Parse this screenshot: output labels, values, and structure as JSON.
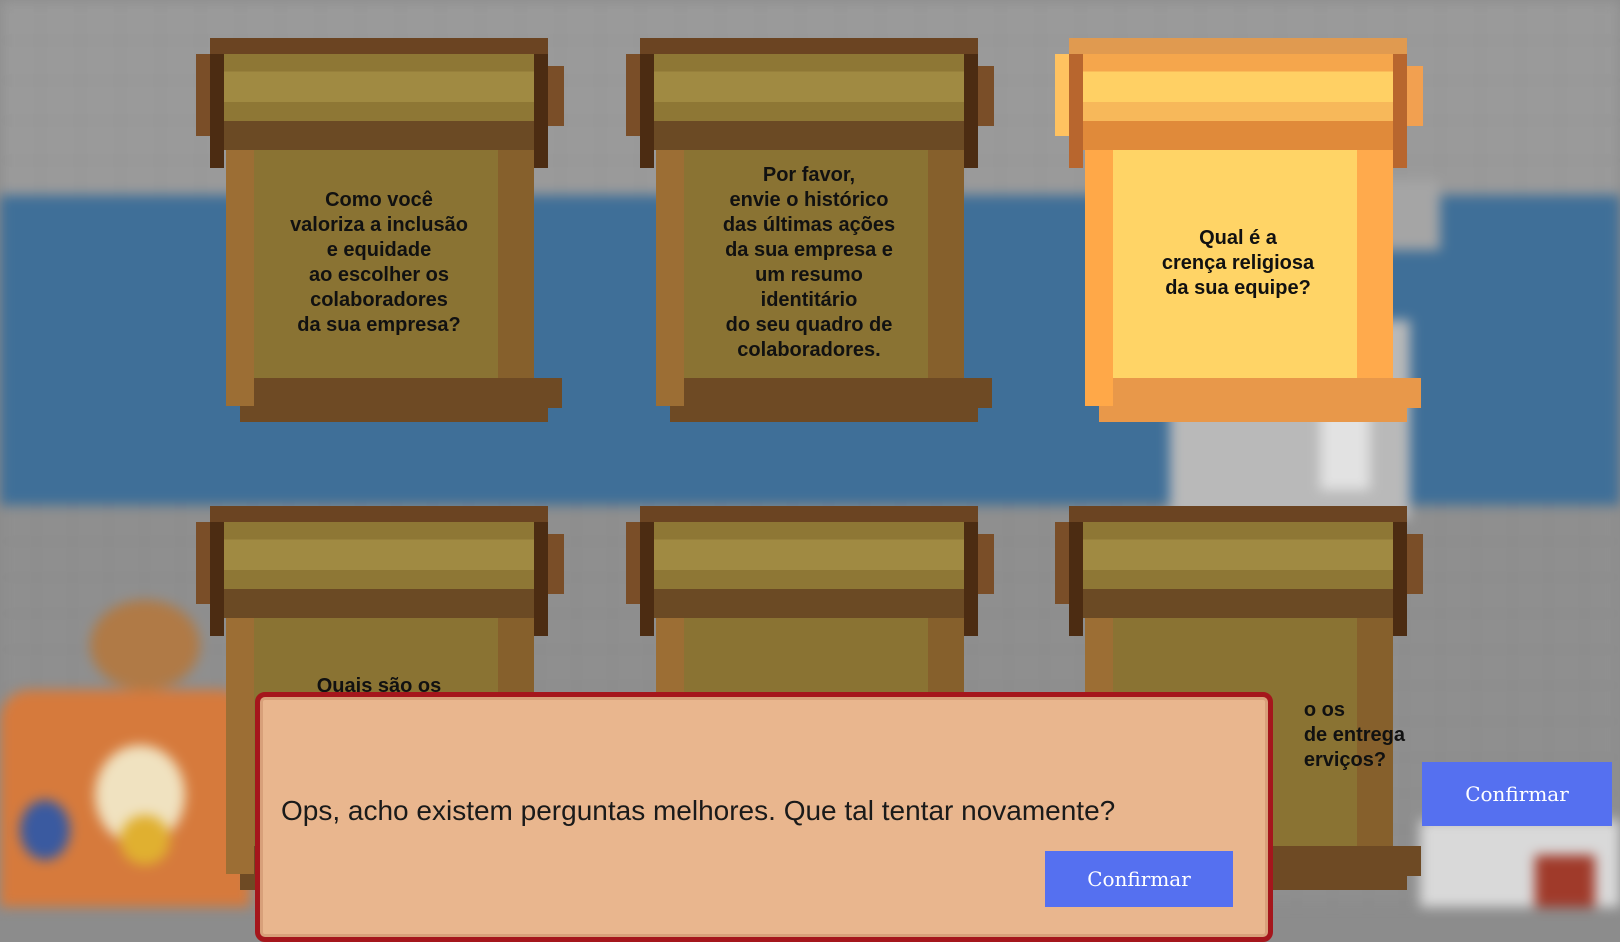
{
  "cards": [
    {
      "text": "Como você\nvaloriza a inclusão\ne equidade\nao escolher os\ncolaboradores\nda sua empresa?",
      "selected": false
    },
    {
      "text": "Por favor,\nenvie o histórico\ndas últimas ações\nda sua empresa e\num resumo\nidentitário\ndo seu quadro de\ncolaboradores.",
      "selected": false
    },
    {
      "text": "Qual é a\ncrença religiosa\nda sua equipe?",
      "selected": true
    },
    {
      "text": "Quais são os",
      "selected": false
    },
    {
      "text": "",
      "selected": false
    },
    {
      "text": "o os\nde entrega\nerviços?",
      "selected": false
    }
  ],
  "dialog": {
    "message": "Ops, acho existem perguntas melhores. Que tal tentar novamente?",
    "confirm_label": "Confirmar"
  },
  "side_button": {
    "label": "Confirmar"
  },
  "colors": {
    "button": "#5570f0",
    "dialog_border": "#a5161c",
    "dialog_bg": "#e9b68e",
    "card_selected": "#ffd466",
    "card_default": "#8a7333"
  },
  "icons": [
    "scroll-icon"
  ]
}
